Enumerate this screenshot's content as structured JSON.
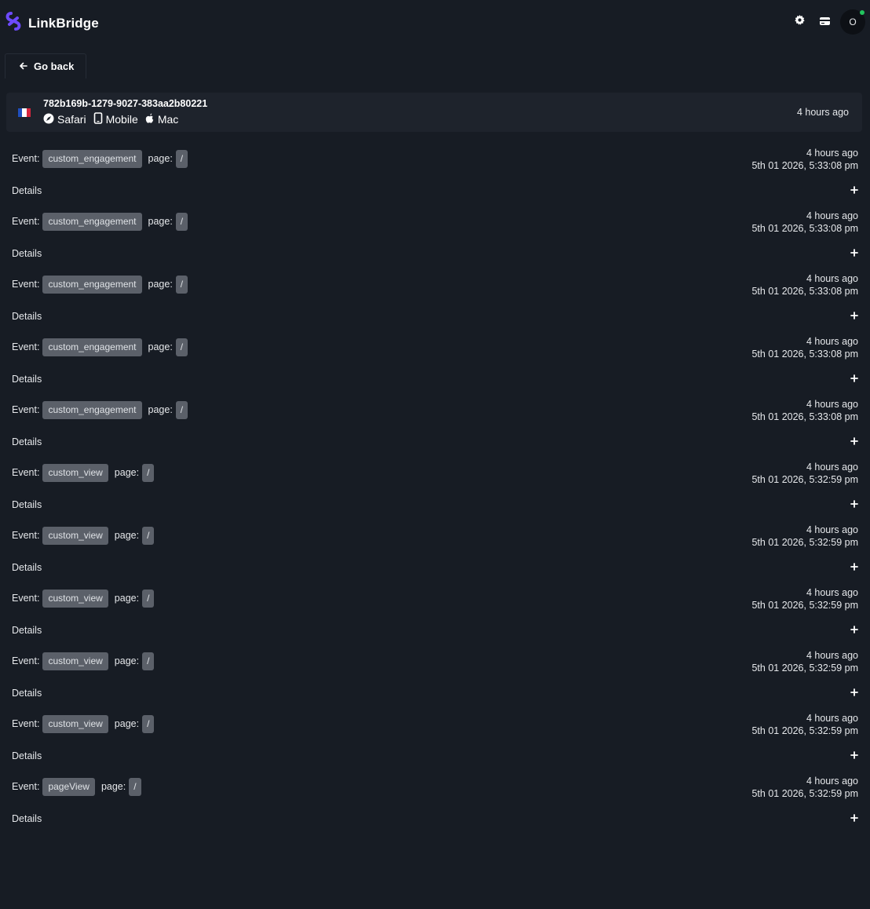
{
  "app": {
    "name": "LinkBridge",
    "avatar_initial": "O",
    "brand_color": "#6d4aff"
  },
  "nav": {
    "back_label": "Go back"
  },
  "session": {
    "id": "782b169b-1279-9027-383aa2b80221",
    "country_flag": "france-flag",
    "browser": "Safari",
    "device": "Mobile",
    "os": "Mac",
    "time_ago": "4 hours ago"
  },
  "labels": {
    "event": "Event:",
    "page": "page:",
    "details": "Details"
  },
  "events": [
    {
      "name": "custom_engagement",
      "page": "/",
      "ago": "4 hours ago",
      "timestamp": "5th 01 2026, 5:33:08 pm"
    },
    {
      "name": "custom_engagement",
      "page": "/",
      "ago": "4 hours ago",
      "timestamp": "5th 01 2026, 5:33:08 pm"
    },
    {
      "name": "custom_engagement",
      "page": "/",
      "ago": "4 hours ago",
      "timestamp": "5th 01 2026, 5:33:08 pm"
    },
    {
      "name": "custom_engagement",
      "page": "/",
      "ago": "4 hours ago",
      "timestamp": "5th 01 2026, 5:33:08 pm"
    },
    {
      "name": "custom_engagement",
      "page": "/",
      "ago": "4 hours ago",
      "timestamp": "5th 01 2026, 5:33:08 pm"
    },
    {
      "name": "custom_view",
      "page": "/",
      "ago": "4 hours ago",
      "timestamp": "5th 01 2026, 5:32:59 pm"
    },
    {
      "name": "custom_view",
      "page": "/",
      "ago": "4 hours ago",
      "timestamp": "5th 01 2026, 5:32:59 pm"
    },
    {
      "name": "custom_view",
      "page": "/",
      "ago": "4 hours ago",
      "timestamp": "5th 01 2026, 5:32:59 pm"
    },
    {
      "name": "custom_view",
      "page": "/",
      "ago": "4 hours ago",
      "timestamp": "5th 01 2026, 5:32:59 pm"
    },
    {
      "name": "custom_view",
      "page": "/",
      "ago": "4 hours ago",
      "timestamp": "5th 01 2026, 5:32:59 pm"
    },
    {
      "name": "pageView",
      "page": "/",
      "ago": "4 hours ago",
      "timestamp": "5th 01 2026, 5:32:59 pm"
    }
  ]
}
